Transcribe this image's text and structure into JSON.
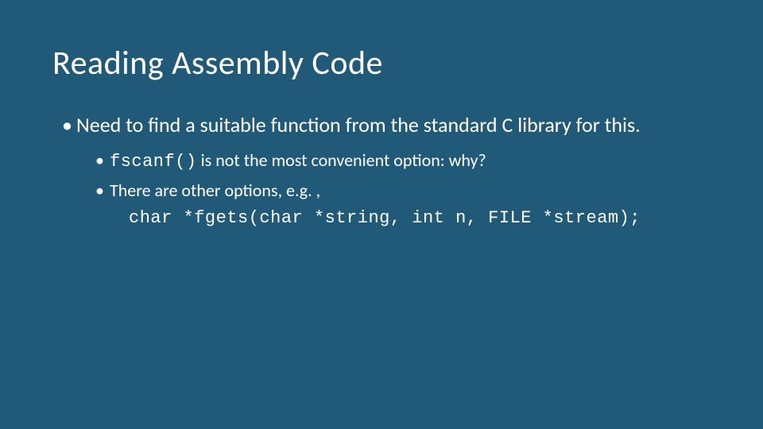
{
  "title": "Reading Assembly Code",
  "bullet1": "Need to find a suitable function from the standard C library for this.",
  "sub1_code": "fscanf()",
  "sub1_rest": " is not the most convenient option: why?",
  "sub2": "There are other options, e.g. ,",
  "code_line": "char *fgets(char *string, int n, FILE *stream);"
}
